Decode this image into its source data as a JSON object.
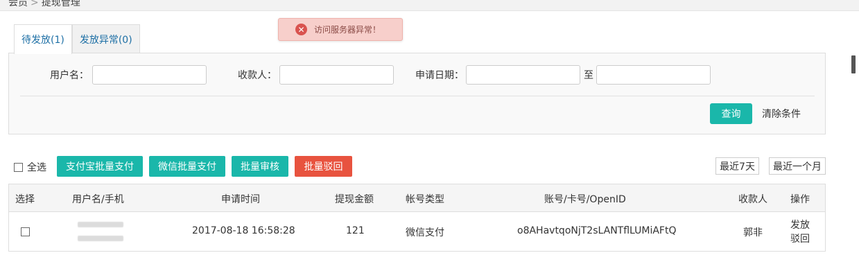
{
  "breadcrumb": {
    "home": "会员",
    "separator": ">",
    "current": "提现管理"
  },
  "toast": {
    "icon": "error-circle-icon",
    "message": "访问服务器异常！",
    "color": "#d9534f"
  },
  "tabs": [
    {
      "label": "待发放(1)",
      "active": true
    },
    {
      "label": "发放异常(0)",
      "active": false
    }
  ],
  "filters": {
    "username_label": "用户名：",
    "username_value": "",
    "payee_label": "收款人：",
    "payee_value": "",
    "date_label": "申请日期：",
    "date_start": "",
    "date_to": "至",
    "date_end": "",
    "query_button": "查询",
    "clear_button": "清除条件"
  },
  "toolbar": {
    "select_all": "全选",
    "alipay_batch": "支付宝批量支付",
    "wechat_batch": "微信批量支付",
    "batch_review": "批量审核",
    "batch_reject": "批量驳回",
    "last_7_days": "最近7天",
    "last_month": "最近一个月"
  },
  "table": {
    "headers": [
      "选择",
      "用户名/手机",
      "申请时间",
      "提现金额",
      "帐号类型",
      "账号/卡号/OpenID",
      "收款人",
      "操作"
    ],
    "rows": [
      {
        "apply_time": "2017-08-18 16:58:28",
        "amount": "121",
        "account_type": "微信支付",
        "account_no": "o8AHavtqoNjT2sLANTflLUMiAFtQ",
        "payee": "郭非",
        "action_issue": "发放",
        "action_reject": "驳回"
      }
    ]
  },
  "colors": {
    "teal": "#1ab7aa",
    "red": "#e8533f",
    "link": "#1d6fa5"
  }
}
